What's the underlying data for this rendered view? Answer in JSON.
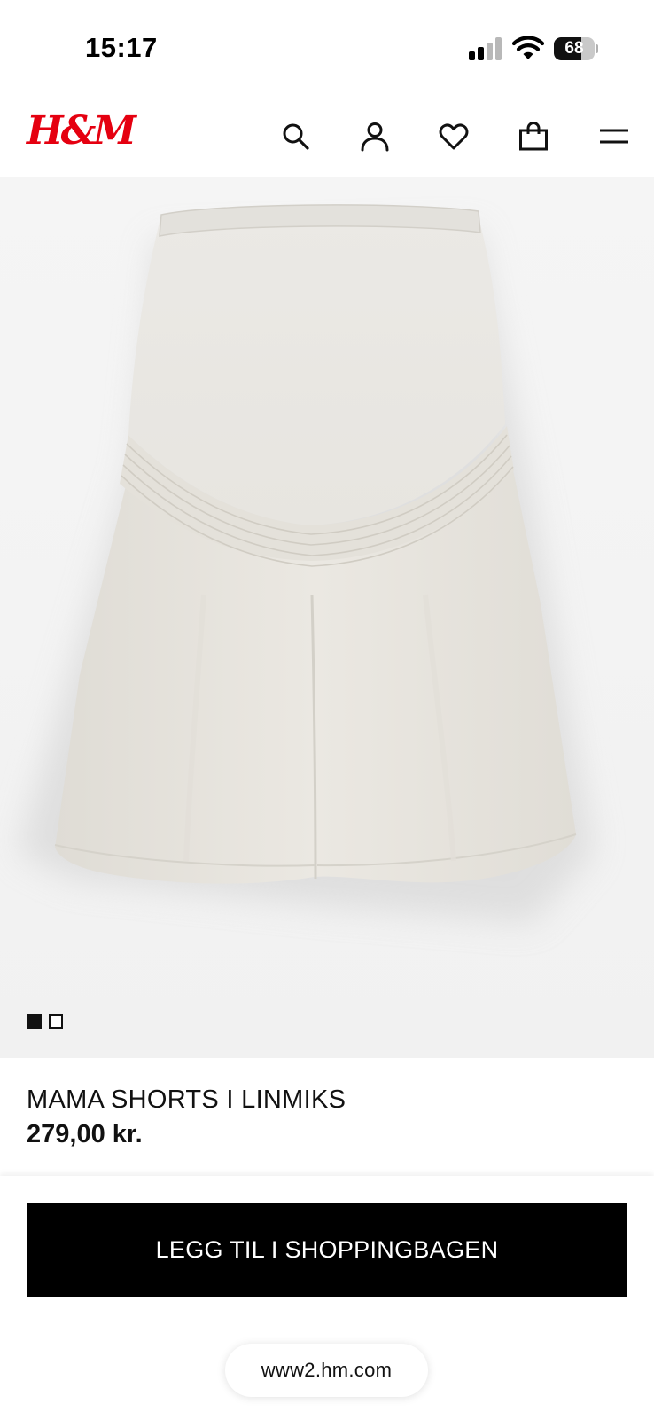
{
  "status_bar": {
    "time": "15:17",
    "battery_level": "68",
    "battery_fraction": 0.68,
    "icons": [
      "signal-icon",
      "wifi-icon",
      "battery-icon"
    ]
  },
  "header": {
    "logo_text": "H&M",
    "brand_color": "#e50010",
    "icons": [
      "search-icon",
      "account-icon",
      "heart-icon",
      "shopping-bag-icon",
      "menu-icon"
    ]
  },
  "gallery": {
    "image_count": 2,
    "active_index": 0
  },
  "product": {
    "name": "MAMA SHORTS I LINMIKS",
    "price": "279,00 kr."
  },
  "actions": {
    "add_to_bag_label": "LEGG TIL I SHOPPINGBAGEN"
  },
  "browser": {
    "url": "www2.hm.com"
  }
}
